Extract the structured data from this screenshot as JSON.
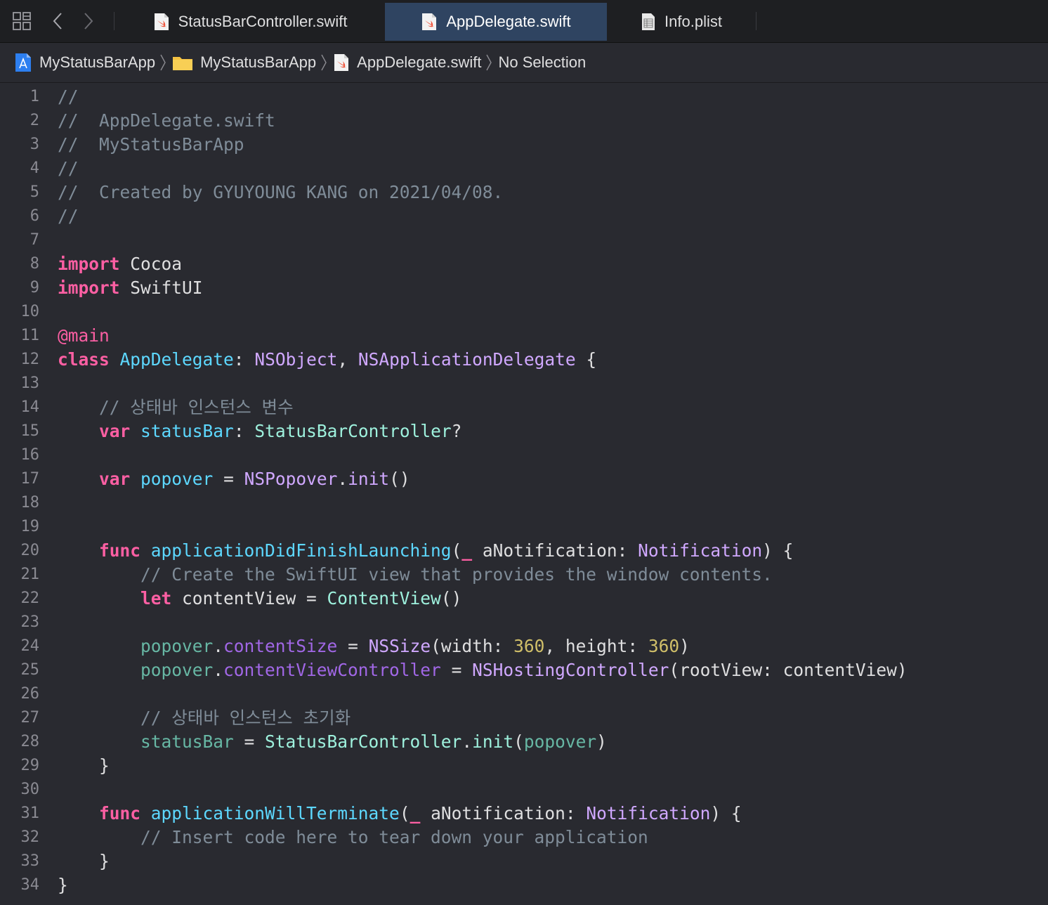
{
  "tabs": [
    {
      "label": "StatusBarController.swift",
      "icon": "swift-file-icon",
      "active": false
    },
    {
      "label": "AppDelegate.swift",
      "icon": "swift-file-icon",
      "active": true
    },
    {
      "label": "Info.plist",
      "icon": "plist-file-icon",
      "active": false
    }
  ],
  "toolbar": {
    "grid_icon": "related-items-grid-icon",
    "back_icon": "chevron-left-icon",
    "forward_icon": "chevron-right-icon"
  },
  "breadcrumb": [
    {
      "label": "MyStatusBarApp",
      "icon": "xcode-project-icon"
    },
    {
      "label": "MyStatusBarApp",
      "icon": "folder-icon"
    },
    {
      "label": "AppDelegate.swift",
      "icon": "swift-file-icon"
    },
    {
      "label": "No Selection",
      "icon": ""
    }
  ],
  "colors": {
    "background": "#292a30",
    "keyword": "#fc5fa3",
    "comment": "#7f8c98",
    "declaration": "#5dd8ff",
    "other_type": "#d0a8ff",
    "project_type": "#9ef1dd",
    "project_property": "#67b7a4",
    "other_property": "#a167e6",
    "number": "#d0bf69",
    "active_tab": "#2f4461"
  },
  "editor": {
    "lines": [
      {
        "n": "1",
        "tokens": [
          [
            "comment",
            "//"
          ]
        ]
      },
      {
        "n": "2",
        "tokens": [
          [
            "comment",
            "//  AppDelegate.swift"
          ]
        ]
      },
      {
        "n": "3",
        "tokens": [
          [
            "comment",
            "//  MyStatusBarApp"
          ]
        ]
      },
      {
        "n": "4",
        "tokens": [
          [
            "comment",
            "//"
          ]
        ]
      },
      {
        "n": "5",
        "tokens": [
          [
            "comment",
            "//  Created by GYUYOUNG KANG on 2021/04/08."
          ]
        ]
      },
      {
        "n": "6",
        "tokens": [
          [
            "comment",
            "//"
          ]
        ]
      },
      {
        "n": "7",
        "tokens": []
      },
      {
        "n": "8",
        "tokens": [
          [
            "kw",
            "import"
          ],
          [
            "plain",
            " Cocoa"
          ]
        ]
      },
      {
        "n": "9",
        "tokens": [
          [
            "kw",
            "import"
          ],
          [
            "plain",
            " SwiftUI"
          ]
        ]
      },
      {
        "n": "10",
        "tokens": []
      },
      {
        "n": "11",
        "tokens": [
          [
            "attr",
            "@main"
          ]
        ]
      },
      {
        "n": "12",
        "tokens": [
          [
            "kw",
            "class"
          ],
          [
            "plain",
            " "
          ],
          [
            "decl",
            "AppDelegate"
          ],
          [
            "plain",
            ": "
          ],
          [
            "typeo",
            "NSObject"
          ],
          [
            "plain",
            ", "
          ],
          [
            "typeo",
            "NSApplicationDelegate"
          ],
          [
            "plain",
            " {"
          ]
        ]
      },
      {
        "n": "13",
        "tokens": []
      },
      {
        "n": "14",
        "tokens": [
          [
            "plain",
            "    "
          ],
          [
            "comment",
            "// 상태바 인스턴스 변수"
          ]
        ]
      },
      {
        "n": "15",
        "tokens": [
          [
            "plain",
            "    "
          ],
          [
            "kw",
            "var"
          ],
          [
            "plain",
            " "
          ],
          [
            "decl",
            "statusBar"
          ],
          [
            "plain",
            ": "
          ],
          [
            "typep",
            "StatusBarController"
          ],
          [
            "plain",
            "?"
          ]
        ]
      },
      {
        "n": "16",
        "tokens": []
      },
      {
        "n": "17",
        "tokens": [
          [
            "plain",
            "    "
          ],
          [
            "kw",
            "var"
          ],
          [
            "plain",
            " "
          ],
          [
            "decl",
            "popover"
          ],
          [
            "plain",
            " = "
          ],
          [
            "typeo",
            "NSPopover"
          ],
          [
            "plain",
            "."
          ],
          [
            "typeo",
            "init"
          ],
          [
            "plain",
            "()"
          ]
        ]
      },
      {
        "n": "18",
        "tokens": []
      },
      {
        "n": "19",
        "tokens": []
      },
      {
        "n": "20",
        "tokens": [
          [
            "plain",
            "    "
          ],
          [
            "kw",
            "func"
          ],
          [
            "plain",
            " "
          ],
          [
            "decl",
            "applicationDidFinishLaunching"
          ],
          [
            "plain",
            "("
          ],
          [
            "kw",
            "_"
          ],
          [
            "plain",
            " aNotification: "
          ],
          [
            "typeo",
            "Notification"
          ],
          [
            "plain",
            ") {"
          ]
        ]
      },
      {
        "n": "21",
        "tokens": [
          [
            "plain",
            "        "
          ],
          [
            "comment",
            "// Create the SwiftUI view that provides the window contents."
          ]
        ]
      },
      {
        "n": "22",
        "tokens": [
          [
            "plain",
            "        "
          ],
          [
            "kw",
            "let"
          ],
          [
            "plain",
            " contentView = "
          ],
          [
            "typep",
            "ContentView"
          ],
          [
            "plain",
            "()"
          ]
        ]
      },
      {
        "n": "23",
        "tokens": []
      },
      {
        "n": "24",
        "tokens": [
          [
            "plain",
            "        "
          ],
          [
            "propp",
            "popover"
          ],
          [
            "plain",
            "."
          ],
          [
            "propo",
            "contentSize"
          ],
          [
            "plain",
            " = "
          ],
          [
            "typeo",
            "NSSize"
          ],
          [
            "plain",
            "(width: "
          ],
          [
            "num",
            "360"
          ],
          [
            "plain",
            ", height: "
          ],
          [
            "num",
            "360"
          ],
          [
            "plain",
            ")"
          ]
        ]
      },
      {
        "n": "25",
        "tokens": [
          [
            "plain",
            "        "
          ],
          [
            "propp",
            "popover"
          ],
          [
            "plain",
            "."
          ],
          [
            "propo",
            "contentViewController"
          ],
          [
            "plain",
            " = "
          ],
          [
            "typeo",
            "NSHostingController"
          ],
          [
            "plain",
            "(rootView: contentView)"
          ]
        ]
      },
      {
        "n": "26",
        "tokens": []
      },
      {
        "n": "27",
        "tokens": [
          [
            "plain",
            "        "
          ],
          [
            "comment",
            "// 상태바 인스턴스 초기화"
          ]
        ]
      },
      {
        "n": "28",
        "tokens": [
          [
            "plain",
            "        "
          ],
          [
            "propp",
            "statusBar"
          ],
          [
            "plain",
            " = "
          ],
          [
            "typep",
            "StatusBarController"
          ],
          [
            "plain",
            "."
          ],
          [
            "typep",
            "init"
          ],
          [
            "plain",
            "("
          ],
          [
            "propp",
            "popover"
          ],
          [
            "plain",
            ")"
          ]
        ]
      },
      {
        "n": "29",
        "tokens": [
          [
            "plain",
            "    }"
          ]
        ]
      },
      {
        "n": "30",
        "tokens": []
      },
      {
        "n": "31",
        "tokens": [
          [
            "plain",
            "    "
          ],
          [
            "kw",
            "func"
          ],
          [
            "plain",
            " "
          ],
          [
            "decl",
            "applicationWillTerminate"
          ],
          [
            "plain",
            "("
          ],
          [
            "kw",
            "_"
          ],
          [
            "plain",
            " aNotification: "
          ],
          [
            "typeo",
            "Notification"
          ],
          [
            "plain",
            ") {"
          ]
        ]
      },
      {
        "n": "32",
        "tokens": [
          [
            "plain",
            "        "
          ],
          [
            "comment",
            "// Insert code here to tear down your application"
          ]
        ]
      },
      {
        "n": "33",
        "tokens": [
          [
            "plain",
            "    }"
          ]
        ]
      },
      {
        "n": "34",
        "tokens": [
          [
            "plain",
            "}"
          ]
        ]
      }
    ]
  }
}
